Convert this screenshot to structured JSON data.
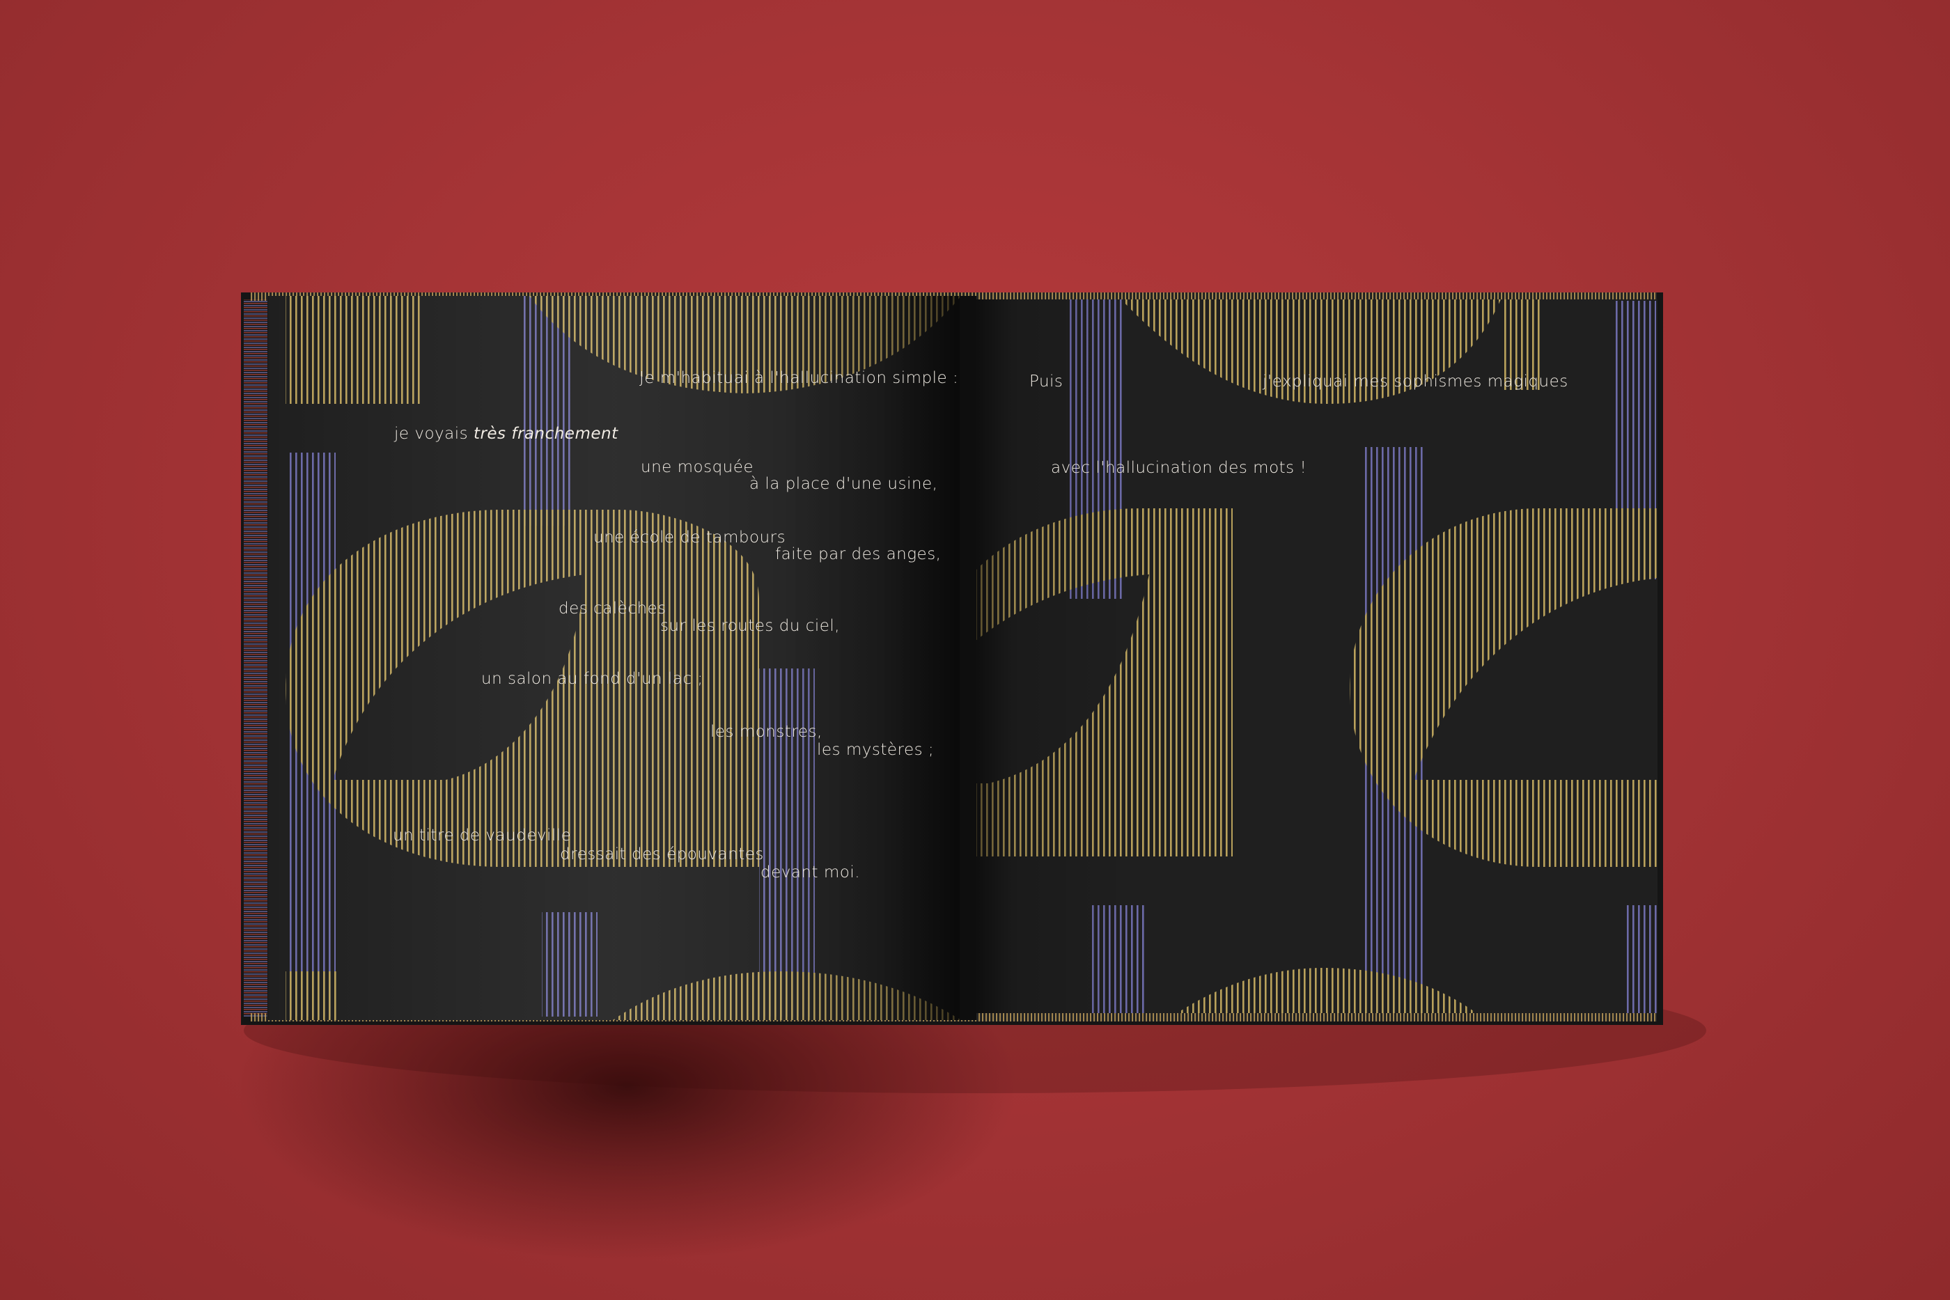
{
  "colors": {
    "background": "#a83537",
    "page": "#1f1f1f",
    "ochre": "#b8a05a",
    "violet": "#6d6aa8",
    "text": "#f1ece4"
  },
  "left_page": {
    "lines": [
      {
        "id": "l1",
        "parts": [
          {
            "text": "Je m'habituai à l'hallucination simple :",
            "italic": false
          }
        ]
      },
      {
        "id": "l2",
        "parts": [
          {
            "text": "je voyais ",
            "italic": false
          },
          {
            "text": "très franchement",
            "italic": true
          }
        ]
      },
      {
        "id": "l3",
        "parts": [
          {
            "text": "une mosquée",
            "italic": false
          }
        ]
      },
      {
        "id": "l4",
        "parts": [
          {
            "text": "à la place d'une usine,",
            "italic": false
          }
        ]
      },
      {
        "id": "l5",
        "parts": [
          {
            "text": "une école de tambours",
            "italic": false
          }
        ]
      },
      {
        "id": "l6",
        "parts": [
          {
            "text": "faite par des anges,",
            "italic": false
          }
        ]
      },
      {
        "id": "l7",
        "parts": [
          {
            "text": "des calèches",
            "italic": false
          }
        ]
      },
      {
        "id": "l8",
        "parts": [
          {
            "text": "sur les routes du ciel,",
            "italic": false
          }
        ]
      },
      {
        "id": "l9",
        "parts": [
          {
            "text": "un salon au fond d'un lac ;",
            "italic": false
          }
        ]
      },
      {
        "id": "l10",
        "parts": [
          {
            "text": "les monstres,",
            "italic": false
          }
        ]
      },
      {
        "id": "l11",
        "parts": [
          {
            "text": "les mystères ;",
            "italic": false
          }
        ]
      },
      {
        "id": "l12",
        "parts": [
          {
            "text": "un titre de vaudeville",
            "italic": false
          }
        ]
      },
      {
        "id": "l13",
        "parts": [
          {
            "text": "dressait des épouvantes",
            "italic": false
          }
        ]
      },
      {
        "id": "l14",
        "parts": [
          {
            "text": "devant moi.",
            "italic": false
          }
        ]
      }
    ]
  },
  "right_page": {
    "lines": [
      {
        "id": "r1",
        "parts": [
          {
            "text": "Puis",
            "italic": false
          }
        ]
      },
      {
        "id": "r2",
        "parts": [
          {
            "text": "j'expliquai mes sophismes magiques",
            "italic": false
          }
        ]
      },
      {
        "id": "r3",
        "parts": [
          {
            "text": "avec l'hallucination des mots !",
            "italic": false
          }
        ]
      }
    ]
  }
}
